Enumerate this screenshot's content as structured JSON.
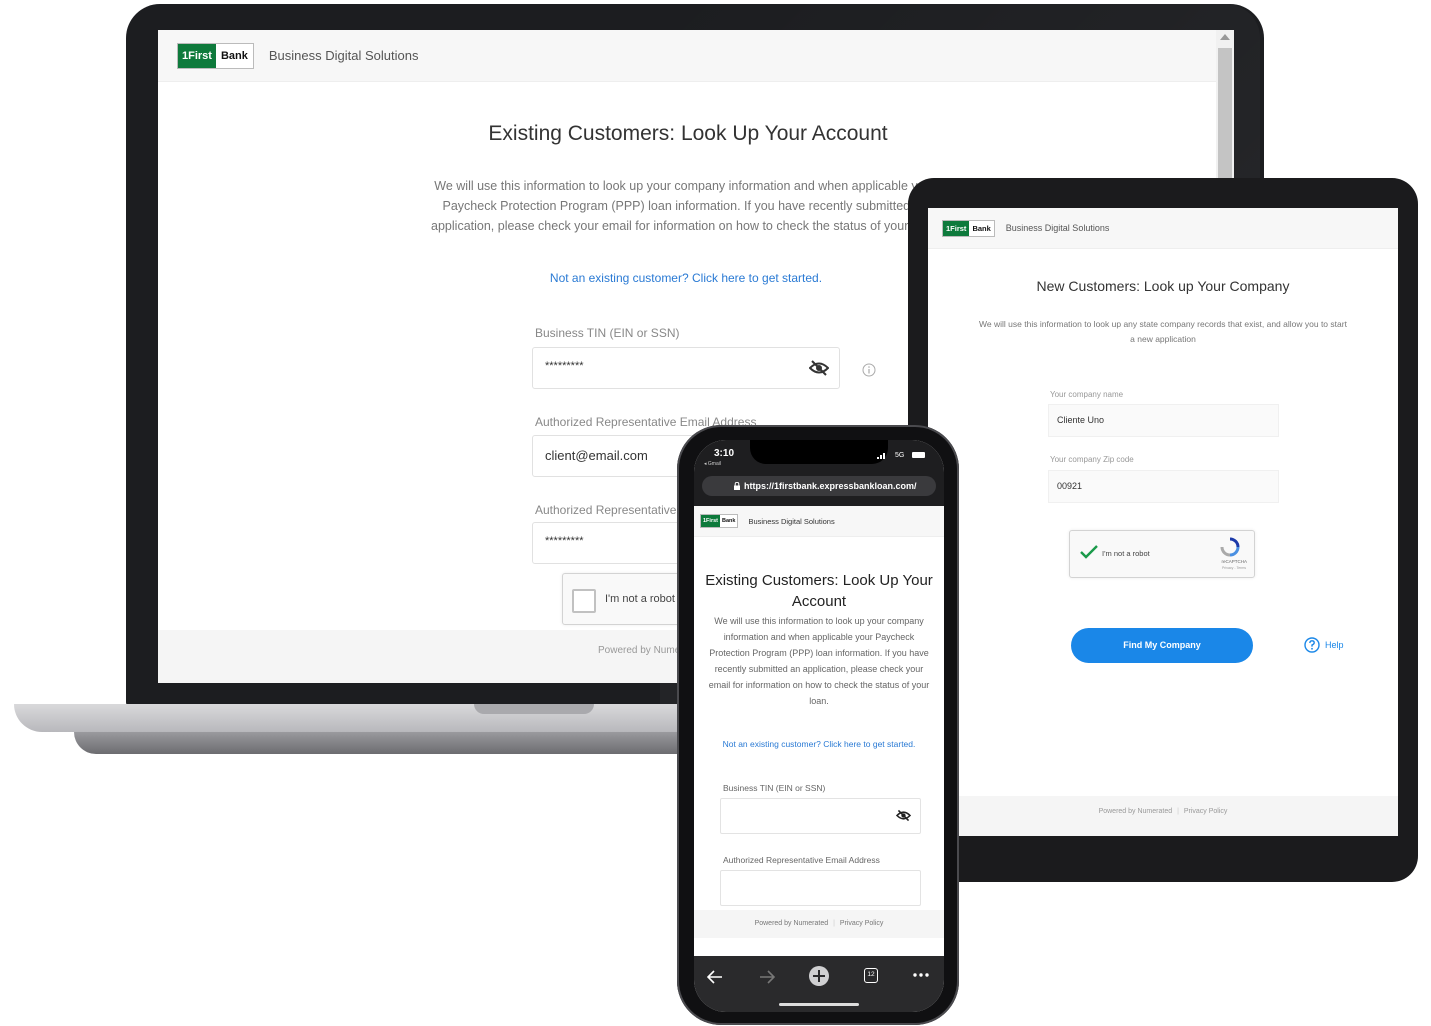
{
  "brand": {
    "logo_left": "1First",
    "logo_right": "Bank",
    "product": "Business Digital Solutions",
    "green": "#0e7a3c",
    "accent": "#1a87e8"
  },
  "laptop": {
    "title": "Existing Customers: Look Up Your Account",
    "description": "We will use this information to look up your company information and when applicable your Paycheck Protection Program (PPP) loan information. If you have recently submitted an application, please check your email for information on how to check the status of your loan.",
    "link": "Not an existing customer? Click here to get started.",
    "tin_label": "Business TIN (EIN or SSN)",
    "tin_value": "*********",
    "email_label": "Authorized Representative Email Address",
    "email_value": "client@email.com",
    "rep_label": "Authorized Representative",
    "rep_value": "*********",
    "captcha_label": "I'm not a robot",
    "footer": "Powered by Nume"
  },
  "tablet": {
    "title": "New Customers: Look up Your Company",
    "description": "We will use this information to look up any state company records that exist, and allow you to start a new application",
    "company_label": "Your company name",
    "company_value": "Cliente Uno",
    "zip_label": "Your company Zip code",
    "zip_value": "00921",
    "captcha_label": "I'm not a robot",
    "captcha_brand": "reCAPTCHA",
    "captcha_terms": "Privacy - Terms",
    "button": "Find My Company",
    "help": "Help",
    "footer_powered": "Powered by Numerated",
    "footer_privacy": "Privacy Policy"
  },
  "phone": {
    "time": "3:10",
    "back_app": "◂ Gmail",
    "network": "5G",
    "url": "https://1firstbank.expressbankloan.com/",
    "title": "Existing Customers: Look Up Your Account",
    "description": "We will use this information to look up your company information and when applicable your Paycheck Protection Program (PPP) loan information. If you have recently submitted an application, please check your email for information on how to check the status of your loan.",
    "link": "Not an existing customer? Click here to get started.",
    "tin_label": "Business TIN (EIN or SSN)",
    "email_label": "Authorized Representative Email Address",
    "footer_powered": "Powered by Numerated",
    "footer_privacy": "Privacy Policy",
    "tab_count": "12"
  }
}
